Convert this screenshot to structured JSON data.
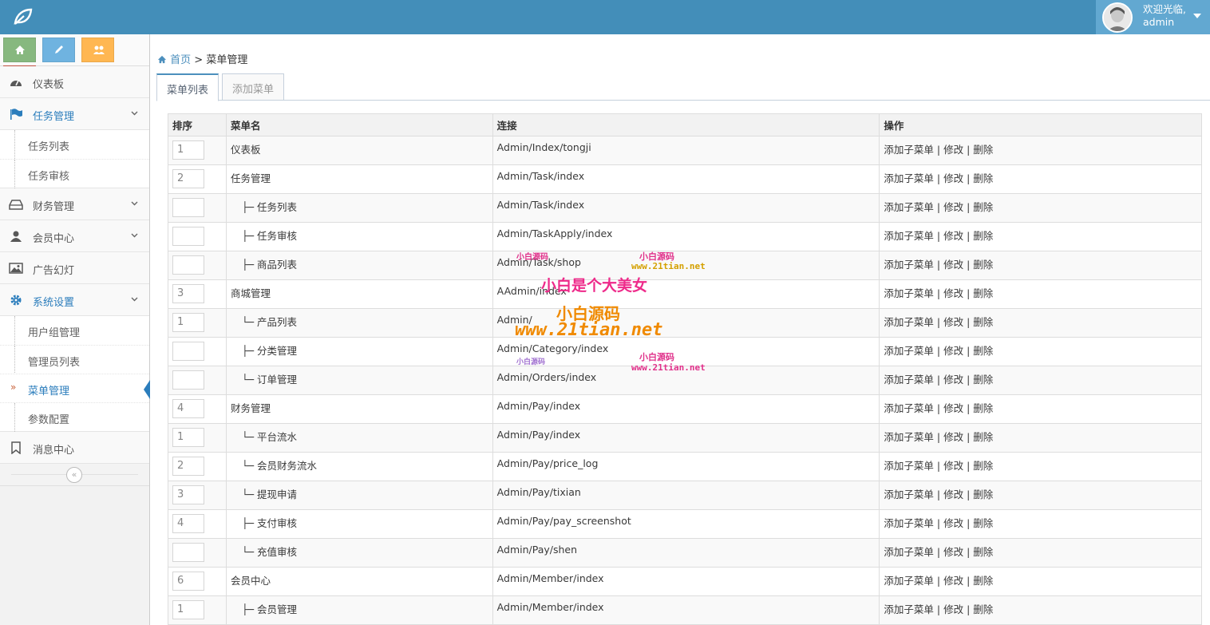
{
  "header": {
    "welcome": "欢迎光临,",
    "username": "admin"
  },
  "sidebar": {
    "shortcuts": [
      {
        "name": "home",
        "color": "#87b87f"
      },
      {
        "name": "pencil",
        "color": "#6fb3e0"
      },
      {
        "name": "users",
        "color": "#ffb752"
      },
      {
        "name": "bell",
        "color": "#d15b47"
      }
    ],
    "items": {
      "dashboard": "仪表板",
      "task": "任务管理",
      "task_list": "任务列表",
      "task_review": "任务审核",
      "finance": "财务管理",
      "members": "会员中心",
      "ads": "广告幻灯",
      "system": "系统设置",
      "user_groups": "用户组管理",
      "admin_list": "管理员列表",
      "menu_manage": "菜单管理",
      "params": "参数配置",
      "messages": "消息中心"
    }
  },
  "breadcrumb": {
    "home": "首页",
    "separator": ">",
    "current": "菜单管理"
  },
  "tabs": [
    "菜单列表",
    "添加菜单"
  ],
  "table": {
    "headers": [
      "排序",
      "菜单名",
      "连接",
      "操作"
    ],
    "ops": {
      "add": "添加子菜单",
      "edit": "修改",
      "del": "删除",
      "sep": "|"
    },
    "rows": [
      {
        "sort": "1",
        "name": "仪表板",
        "prefix": "",
        "link": "Admin/Index/tongji"
      },
      {
        "sort": "2",
        "name": "任务管理",
        "prefix": "",
        "link": "Admin/Task/index"
      },
      {
        "sort": "",
        "name": "任务列表",
        "prefix": "├─",
        "link": "Admin/Task/index"
      },
      {
        "sort": "",
        "name": "任务审核",
        "prefix": "├─",
        "link": "Admin/TaskApply/index"
      },
      {
        "sort": "",
        "name": "商品列表",
        "prefix": "├─",
        "link": "Admin/Task/shop"
      },
      {
        "sort": "3",
        "name": "商城管理",
        "prefix": "",
        "link": "AAdmin/index"
      },
      {
        "sort": "1",
        "name": "产品列表",
        "prefix": "└─",
        "link": "Admin/"
      },
      {
        "sort": "",
        "name": "分类管理",
        "prefix": "├─",
        "link": "Admin/Category/index"
      },
      {
        "sort": "",
        "name": "订单管理",
        "prefix": "└─",
        "link": "Admin/Orders/index"
      },
      {
        "sort": "4",
        "name": "财务管理",
        "prefix": "",
        "link": "Admin/Pay/index"
      },
      {
        "sort": "1",
        "name": "平台流水",
        "prefix": "└─",
        "link": "Admin/Pay/index"
      },
      {
        "sort": "2",
        "name": "会员财务流水",
        "prefix": "└─",
        "link": "Admin/Pay/price_log"
      },
      {
        "sort": "3",
        "name": "提现申请",
        "prefix": "└─",
        "link": "Admin/Pay/tixian"
      },
      {
        "sort": "4",
        "name": "支付审核",
        "prefix": "├─",
        "link": "Admin/Pay/pay_screenshot"
      },
      {
        "sort": "",
        "name": "充值审核",
        "prefix": "└─",
        "link": "Admin/Pay/shen"
      },
      {
        "sort": "6",
        "name": "会员中心",
        "prefix": "",
        "link": "Admin/Member/index"
      },
      {
        "sort": "1",
        "name": "会员管理",
        "prefix": "├─",
        "link": "Admin/Member/index"
      }
    ]
  },
  "watermark": {
    "line1": "小白是个大美女",
    "line2": "小白源码",
    "line3": "www.21tian.net",
    "small_a": "小白源码",
    "small_b": "www.21tian.net"
  }
}
